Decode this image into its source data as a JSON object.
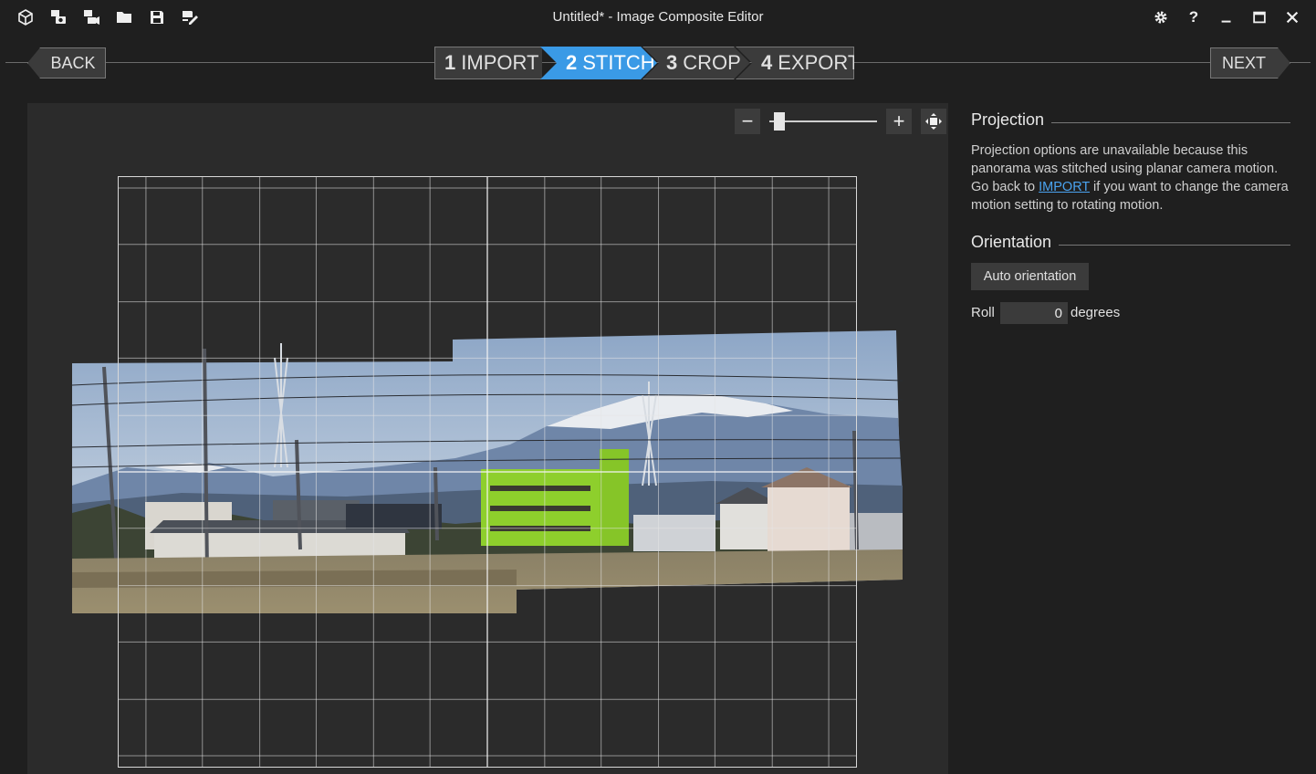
{
  "window": {
    "title": "Untitled* - Image Composite Editor",
    "toolbar_icons": [
      "new-project-icon",
      "new-panorama-from-images-icon",
      "new-panorama-from-video-icon",
      "open-folder-icon",
      "save-icon",
      "save-as-icon"
    ],
    "controls": [
      "settings-icon",
      "help-icon",
      "minimize-icon",
      "maximize-icon",
      "close-icon"
    ]
  },
  "nav": {
    "back_label": "BACK",
    "next_label": "NEXT",
    "steps": [
      {
        "num": "1",
        "label": "IMPORT"
      },
      {
        "num": "2",
        "label": "STITCH"
      },
      {
        "num": "3",
        "label": "CROP"
      },
      {
        "num": "4",
        "label": "EXPORT"
      }
    ],
    "active_step": "2",
    "accent_color": "#3a9ae6"
  },
  "zoom": {
    "minus_label": "−",
    "plus_label": "+",
    "level": 0.05
  },
  "panel": {
    "projection": {
      "heading": "Projection",
      "text_before_link": "Projection options are unavailable because this panorama was stitched using planar camera motion. Go back to ",
      "link_text": "IMPORT",
      "text_after_link": " if you want to change the camera motion setting to rotating motion."
    },
    "orientation": {
      "heading": "Orientation",
      "auto_button": "Auto orientation",
      "roll_label": "Roll",
      "roll_value": "0",
      "roll_unit": "degrees"
    }
  }
}
